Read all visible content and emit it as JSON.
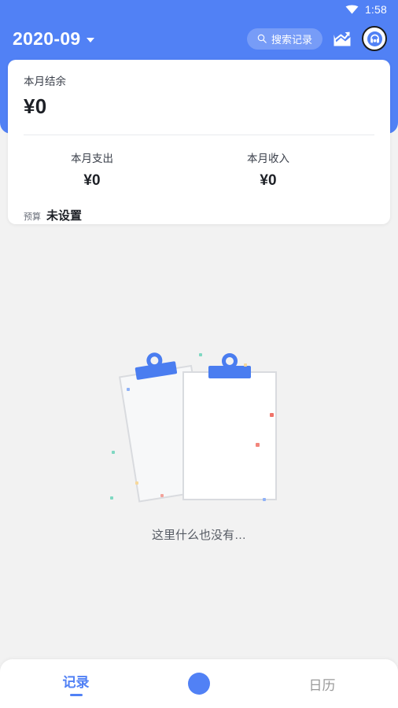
{
  "status_bar": {
    "time": "1:58",
    "wifi_icon": "wifi-icon"
  },
  "app_bar": {
    "month": "2020-09",
    "dropdown_icon": "chevron-down-icon",
    "search": {
      "placeholder": "搜索记录",
      "icon": "search-icon"
    },
    "chart_icon": "chart-trending-up-icon",
    "avatar_icon": "user-avatar-icon"
  },
  "summary_card": {
    "balance_label": "本月结余",
    "balance_value": "¥0",
    "expense_label": "本月支出",
    "expense_value": "¥0",
    "income_label": "本月收入",
    "income_value": "¥0",
    "budget_label": "预算",
    "budget_value": "未设置"
  },
  "empty_state": {
    "text": "这里什么也没有…",
    "illustration": "empty-clipboard-illustration"
  },
  "bottom_nav": {
    "records_label": "记录",
    "calendar_label": "日历",
    "add_button_icon": "add-record-fab"
  },
  "colors": {
    "brand_blue": "#5181f5",
    "page_background": "#f2f2f2",
    "card_background": "#ffffff",
    "inactive_nav": "#9a9a9a",
    "text_primary": "#1d2026"
  }
}
